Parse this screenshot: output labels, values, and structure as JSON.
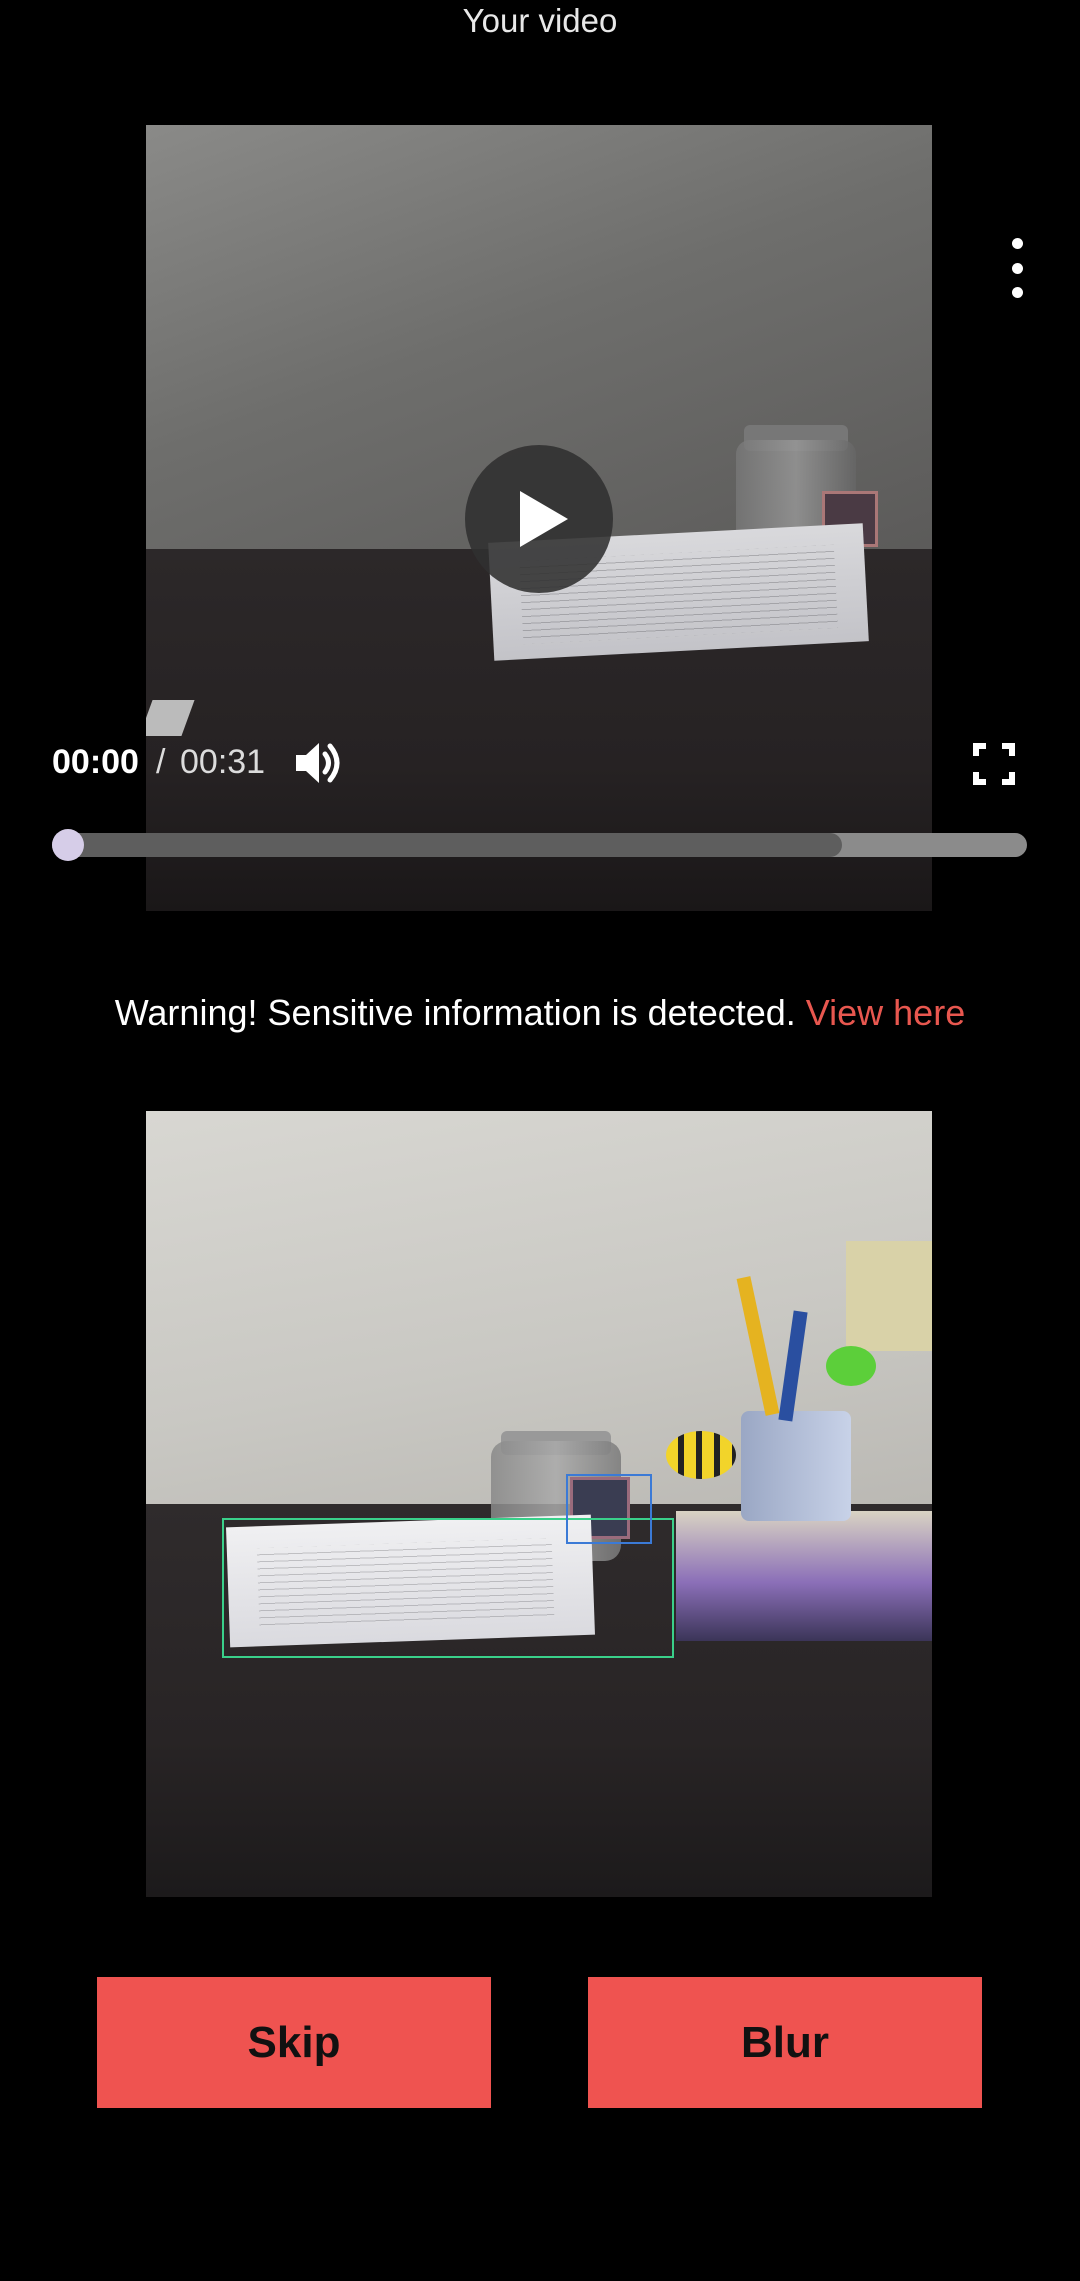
{
  "header": {
    "title": "Your video"
  },
  "player": {
    "current_time": "00:00",
    "separator": "/",
    "total_time": "00:31",
    "progress": 0.0,
    "buffered": 0.81
  },
  "warning": {
    "message": "Warning! Sensitive information is detected.",
    "link_text": "View here",
    "link_color": "#e8574f"
  },
  "detections": [
    {
      "label": "document",
      "color": "#3ad08a"
    },
    {
      "label": "card",
      "color": "#3b7ad6"
    }
  ],
  "actions": {
    "skip_label": "Skip",
    "blur_label": "Blur",
    "button_color": "#ef5350"
  },
  "icons": {
    "menu": "more-vertical-icon",
    "play": "play-icon",
    "volume": "volume-icon",
    "fullscreen": "fullscreen-icon"
  }
}
